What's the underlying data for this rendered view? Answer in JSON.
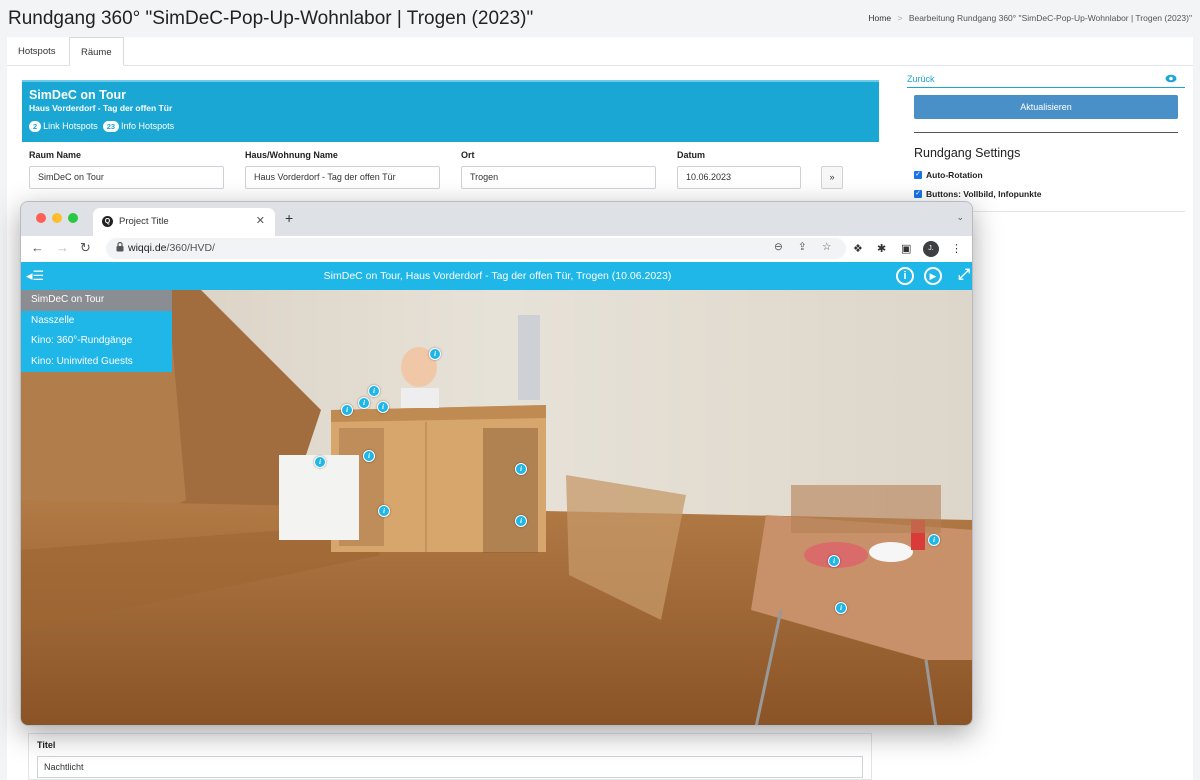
{
  "page": {
    "title": "Rundgang 360° \"SimDeC-Pop-Up-Wohnlabor | Trogen (2023)\"",
    "breadcrumb": {
      "home": "Home",
      "separator": ">",
      "current": "Bearbeitung Rundgang 360° \"SimDeC-Pop-Up-Wohnlabor | Trogen (2023)\""
    }
  },
  "tabs": [
    {
      "label": "Hotspots",
      "active": false
    },
    {
      "label": "Räume",
      "active": true
    }
  ],
  "room_banner": {
    "title": "SimDeC on Tour",
    "subtitle": "Haus Vorderdorf - Tag der offen Tür",
    "link_hotspots_count": "2",
    "link_hotspots_label": "Link Hotspots",
    "info_hotspots_count": "23",
    "info_hotspots_label": "Info Hotspots"
  },
  "form": {
    "raum_name": {
      "label": "Raum Name",
      "value": "SimDeC on Tour"
    },
    "haus_name": {
      "label": "Haus/Wohnung Name",
      "value": "Haus Vorderdorf - Tag der offen Tür"
    },
    "ort": {
      "label": "Ort",
      "value": "Trogen"
    },
    "datum": {
      "label": "Datum",
      "value": "10.06.2023"
    },
    "next_label": "»"
  },
  "sidebar": {
    "back_label": "Zurück",
    "update_label": "Aktualisieren",
    "settings_heading": "Rundgang Settings",
    "checkboxes": [
      {
        "label": "Auto-Rotation",
        "checked": true
      },
      {
        "label": "Buttons: Vollbild, Infopunkte",
        "checked": true
      }
    ]
  },
  "titel": {
    "label": "Titel",
    "value": "Nachtlicht"
  },
  "browser": {
    "tab_title": "Project Title",
    "url_host": "wiqqi.de",
    "url_path": "/360/HVD/",
    "avatar_initial": "J."
  },
  "tour": {
    "title": "SimDeC on Tour, Haus Vorderdorf - Tag der offen Tür, Trogen (10.06.2023)",
    "rooms": [
      {
        "label": "SimDeC on Tour",
        "active": true
      },
      {
        "label": "Nasszelle",
        "active": false
      },
      {
        "label": "Kino: 360°-Rundgänge",
        "active": false
      },
      {
        "label": "Kino: Uninvited Guests",
        "active": false
      }
    ],
    "hotspot_glyph": "i"
  },
  "colors": {
    "accent": "#1aa7d4",
    "tour_bar": "#1fb6e8",
    "button": "#4a90c8"
  }
}
